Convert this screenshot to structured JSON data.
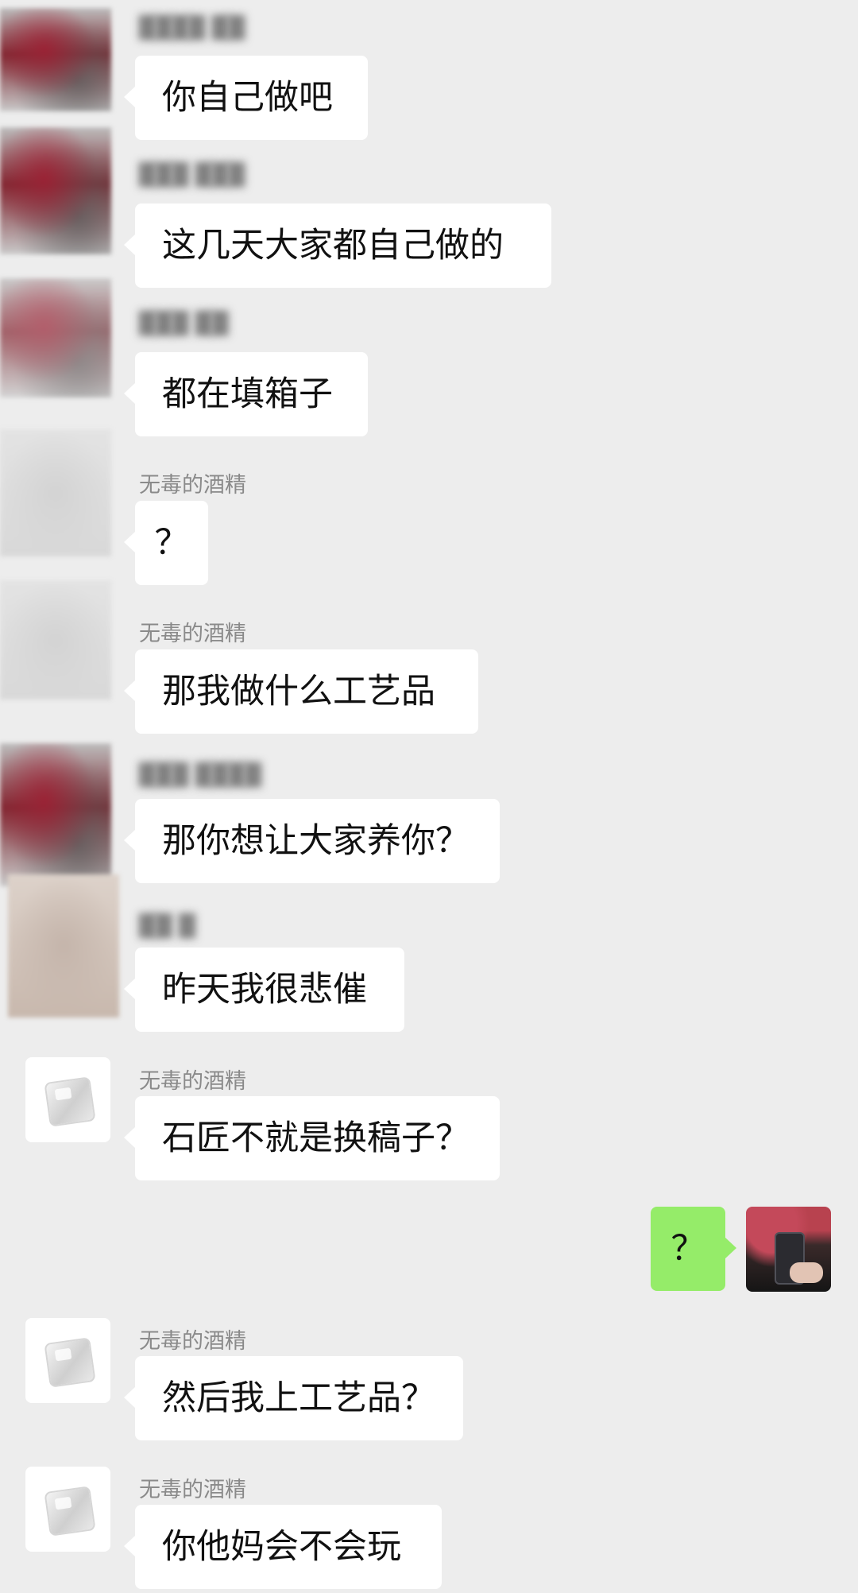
{
  "chat": {
    "messages": [
      {
        "sender": "",
        "text": "你自己做吧"
      },
      {
        "sender": "",
        "text": "这几天大家都自己做的"
      },
      {
        "sender": "",
        "text": "都在填箱子"
      },
      {
        "sender": "无毒的酒精",
        "text": "？"
      },
      {
        "sender": "无毒的酒精",
        "text": "那我做什么工艺品"
      },
      {
        "sender": "",
        "text": "那你想让大家养你？"
      },
      {
        "sender": "",
        "text": "昨天我很悲催"
      },
      {
        "sender": "无毒的酒精",
        "text": "石匠不就是换稿子？"
      },
      {
        "sender": "me",
        "text": "？"
      },
      {
        "sender": "无毒的酒精",
        "text": "然后我上工艺品？"
      },
      {
        "sender": "无毒的酒精",
        "text": "你他妈会不会玩"
      }
    ]
  }
}
